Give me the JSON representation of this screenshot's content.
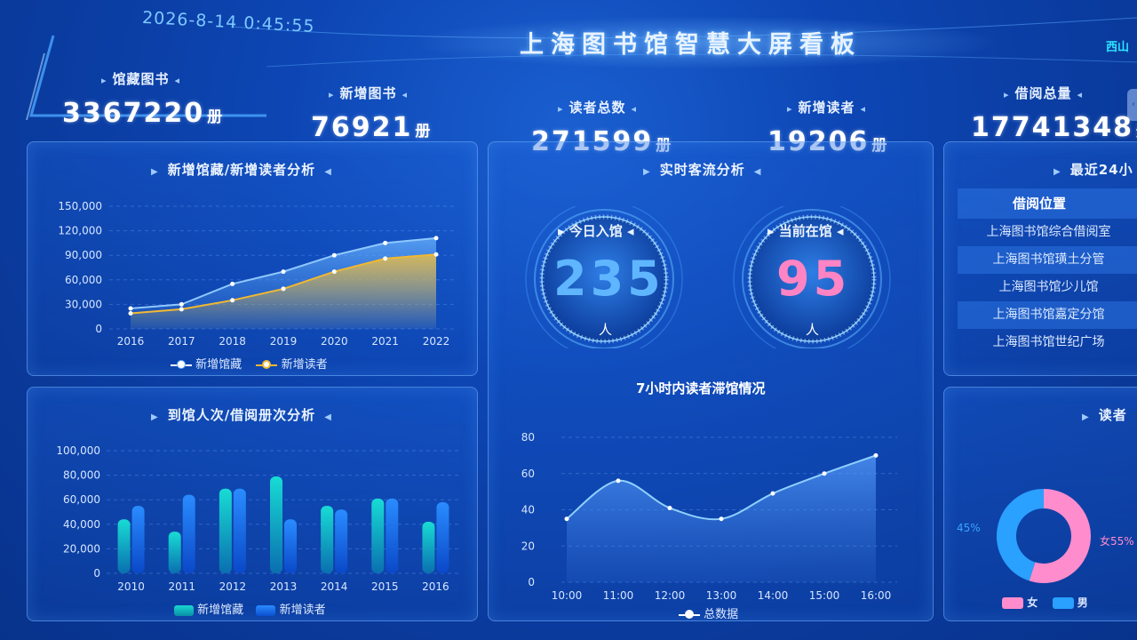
{
  "header": {
    "datetime": "2026-8-14 0:45:55",
    "title": "上海图书馆智慧大屏看板",
    "location": "西山"
  },
  "kpis": [
    {
      "label": "馆藏图书",
      "value": "3367220",
      "unit": "册"
    },
    {
      "label": "新增图书",
      "value": "76921",
      "unit": "册"
    },
    {
      "label": "读者总数",
      "value": "271599",
      "unit": "册"
    },
    {
      "label": "新增读者",
      "value": "19206",
      "unit": "册"
    },
    {
      "label": "借阅总量",
      "value": "17741348",
      "unit": "册"
    }
  ],
  "panels": {
    "collection_title": "新增馆藏/新增读者分析",
    "visits_title": "到馆人次/借阅册次分析",
    "realtime_title": "实时客流分析",
    "stay_title": "7小时内读者滞馆情况",
    "recent_title": "最近24小",
    "reader_title": "读者"
  },
  "gauges": {
    "today_label": "今日入馆",
    "today_value": "235",
    "today_unit": "人",
    "current_label": "当前在馆",
    "current_value": "95",
    "current_unit": "人"
  },
  "table": {
    "header": "借阅位置",
    "rows": [
      "上海图书馆综合借阅室",
      "上海图书馆璜土分管",
      "上海图书馆少儿馆",
      "上海图书馆嘉定分馆",
      "上海图书馆世纪广场"
    ]
  },
  "donut": {
    "left_label": "45%",
    "right_label": "女55%",
    "legend": [
      "女",
      "男"
    ]
  },
  "colors": {
    "series_blue": "#5aa8ff",
    "series_yellow": "#f2b830",
    "bar_cyan": "#10c8c8",
    "bar_blue": "#1e78ff",
    "pink": "#ff8ccc"
  },
  "chart_data": [
    {
      "type": "area",
      "categories": [
        "2016",
        "2017",
        "2018",
        "2019",
        "2020",
        "2021",
        "2022"
      ],
      "series": [
        {
          "name": "新增馆藏",
          "values": [
            25000,
            30000,
            55000,
            70000,
            90000,
            105000,
            111000
          ]
        },
        {
          "name": "新增读者",
          "values": [
            19000,
            24000,
            35000,
            49000,
            70000,
            86000,
            91000
          ]
        }
      ],
      "yticks": [
        "0",
        "30,000",
        "60,000",
        "90,000",
        "120,000",
        "150,000"
      ],
      "ylim": [
        0,
        150000
      ],
      "legend": "bottom"
    },
    {
      "type": "bar",
      "categories": [
        "2010",
        "2011",
        "2012",
        "2013",
        "2014",
        "2015",
        "2016"
      ],
      "series": [
        {
          "name": "新增馆藏",
          "values": [
            44000,
            34000,
            69000,
            79000,
            55000,
            61000,
            42000
          ]
        },
        {
          "name": "新增读者",
          "values": [
            55000,
            64000,
            69000,
            44000,
            52000,
            61000,
            58000
          ]
        }
      ],
      "yticks": [
        "0",
        "20,000",
        "40,000",
        "60,000",
        "80,000",
        "100,000"
      ],
      "ylim": [
        0,
        100000
      ],
      "legend": "bottom"
    },
    {
      "type": "area",
      "categories": [
        "10:00",
        "11:00",
        "12:00",
        "13:00",
        "14:00",
        "15:00",
        "16:00"
      ],
      "series": [
        {
          "name": "总数据",
          "values": [
            35,
            56,
            41,
            35,
            49,
            60,
            70
          ]
        }
      ],
      "yticks": [
        "0",
        "20",
        "40",
        "60",
        "80"
      ],
      "ylim": [
        0,
        80
      ],
      "legend": "bottom"
    },
    {
      "type": "pie",
      "categories": [
        "女",
        "男"
      ],
      "values": [
        55,
        45
      ]
    }
  ]
}
